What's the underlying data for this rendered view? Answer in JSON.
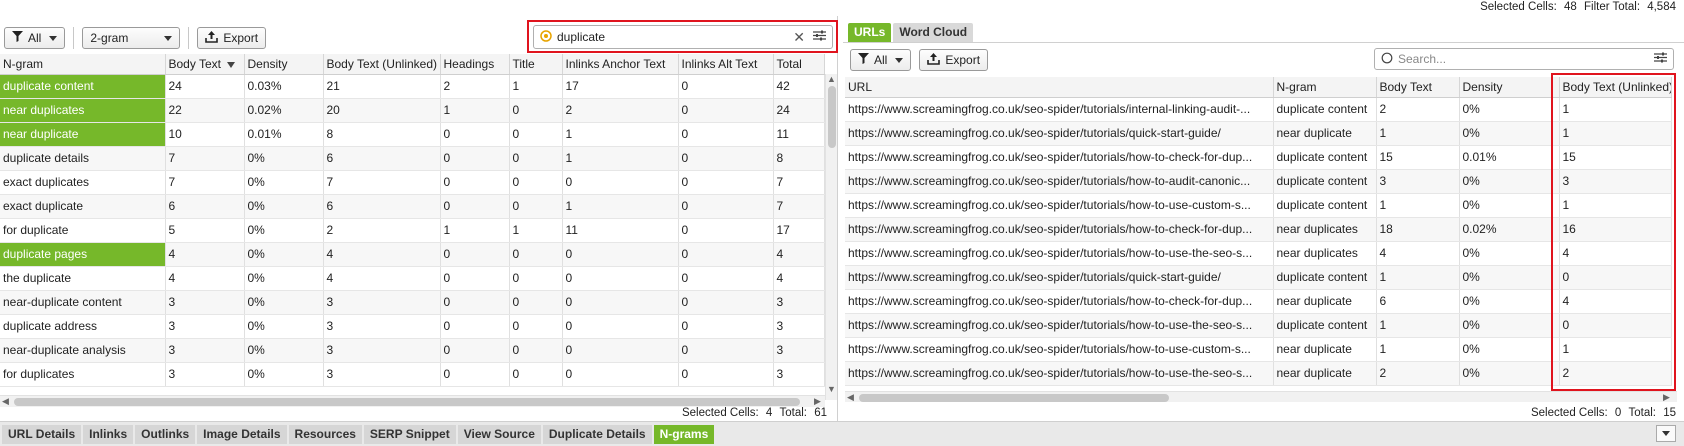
{
  "top_status": {
    "selected_label": "Selected Cells:",
    "selected_value": "48",
    "filter_label": "Filter Total:",
    "filter_value": "4,584"
  },
  "left": {
    "filter_button": "All",
    "ngram_select": "2-gram",
    "export_button": "Export",
    "search_value": "duplicate",
    "columns": [
      "N-gram",
      "Body Text",
      "Density",
      "Body Text (Unlinked)",
      "Headings",
      "Title",
      "Inlinks Anchor Text",
      "Inlinks Alt Text",
      "Total"
    ],
    "rows": [
      {
        "cells": [
          "duplicate content",
          "24",
          "0.03%",
          "21",
          "2",
          "1",
          "17",
          "0",
          "42"
        ],
        "hl": true
      },
      {
        "cells": [
          "near duplicates",
          "22",
          "0.02%",
          "20",
          "1",
          "0",
          "2",
          "0",
          "24"
        ],
        "hl": true
      },
      {
        "cells": [
          "near duplicate",
          "10",
          "0.01%",
          "8",
          "0",
          "0",
          "1",
          "0",
          "11"
        ],
        "hl": true
      },
      {
        "cells": [
          "duplicate details",
          "7",
          "0%",
          "6",
          "0",
          "0",
          "1",
          "0",
          "8"
        ],
        "hl": false
      },
      {
        "cells": [
          "exact duplicates",
          "7",
          "0%",
          "7",
          "0",
          "0",
          "0",
          "0",
          "7"
        ],
        "hl": false
      },
      {
        "cells": [
          "exact duplicate",
          "6",
          "0%",
          "6",
          "0",
          "0",
          "1",
          "0",
          "7"
        ],
        "hl": false
      },
      {
        "cells": [
          "for duplicate",
          "5",
          "0%",
          "2",
          "1",
          "1",
          "11",
          "0",
          "17"
        ],
        "hl": false
      },
      {
        "cells": [
          "duplicate pages",
          "4",
          "0%",
          "4",
          "0",
          "0",
          "0",
          "0",
          "4"
        ],
        "hl": true
      },
      {
        "cells": [
          "the duplicate",
          "4",
          "0%",
          "4",
          "0",
          "0",
          "0",
          "0",
          "4"
        ],
        "hl": false
      },
      {
        "cells": [
          "near-duplicate content",
          "3",
          "0%",
          "3",
          "0",
          "0",
          "0",
          "0",
          "3"
        ],
        "hl": false
      },
      {
        "cells": [
          "duplicate address",
          "3",
          "0%",
          "3",
          "0",
          "0",
          "0",
          "0",
          "3"
        ],
        "hl": false
      },
      {
        "cells": [
          "near-duplicate analysis",
          "3",
          "0%",
          "3",
          "0",
          "0",
          "0",
          "0",
          "3"
        ],
        "hl": false
      },
      {
        "cells": [
          "for duplicates",
          "3",
          "0%",
          "3",
          "0",
          "0",
          "0",
          "0",
          "3"
        ],
        "hl": false
      }
    ],
    "status": {
      "selected_label": "Selected Cells:",
      "selected_value": "4",
      "total_label": "Total:",
      "total_value": "61"
    }
  },
  "right": {
    "tabs": [
      {
        "label": "URLs",
        "active": true
      },
      {
        "label": "Word Cloud",
        "active": false
      }
    ],
    "filter_button": "All",
    "export_button": "Export",
    "search_placeholder": "Search...",
    "columns": [
      "URL",
      "N-gram",
      "Body Text",
      "Density",
      "Body Text (Unlinked)"
    ],
    "rows": [
      [
        "https://www.screamingfrog.co.uk/seo-spider/tutorials/internal-linking-audit-...",
        "duplicate content",
        "2",
        "0%",
        "1"
      ],
      [
        "https://www.screamingfrog.co.uk/seo-spider/tutorials/quick-start-guide/",
        "near duplicate",
        "1",
        "0%",
        "1"
      ],
      [
        "https://www.screamingfrog.co.uk/seo-spider/tutorials/how-to-check-for-dup...",
        "duplicate content",
        "15",
        "0.01%",
        "15"
      ],
      [
        "https://www.screamingfrog.co.uk/seo-spider/tutorials/how-to-audit-canonic...",
        "duplicate content",
        "3",
        "0%",
        "3"
      ],
      [
        "https://www.screamingfrog.co.uk/seo-spider/tutorials/how-to-use-custom-s...",
        "duplicate content",
        "1",
        "0%",
        "1"
      ],
      [
        "https://www.screamingfrog.co.uk/seo-spider/tutorials/how-to-check-for-dup...",
        "near duplicates",
        "18",
        "0.02%",
        "16"
      ],
      [
        "https://www.screamingfrog.co.uk/seo-spider/tutorials/how-to-use-the-seo-s...",
        "near duplicates",
        "4",
        "0%",
        "4"
      ],
      [
        "https://www.screamingfrog.co.uk/seo-spider/tutorials/quick-start-guide/",
        "duplicate content",
        "1",
        "0%",
        "0"
      ],
      [
        "https://www.screamingfrog.co.uk/seo-spider/tutorials/how-to-check-for-dup...",
        "near duplicate",
        "6",
        "0%",
        "4"
      ],
      [
        "https://www.screamingfrog.co.uk/seo-spider/tutorials/how-to-use-the-seo-s...",
        "duplicate content",
        "1",
        "0%",
        "0"
      ],
      [
        "https://www.screamingfrog.co.uk/seo-spider/tutorials/how-to-use-custom-s...",
        "near duplicate",
        "1",
        "0%",
        "1"
      ],
      [
        "https://www.screamingfrog.co.uk/seo-spider/tutorials/how-to-use-the-seo-s...",
        "near duplicate",
        "2",
        "0%",
        "2"
      ]
    ],
    "status": {
      "selected_label": "Selected Cells:",
      "selected_value": "0",
      "total_label": "Total:",
      "total_value": "15"
    }
  },
  "bottom_tabs": [
    {
      "label": "URL Details",
      "active": false
    },
    {
      "label": "Inlinks",
      "active": false
    },
    {
      "label": "Outlinks",
      "active": false
    },
    {
      "label": "Image Details",
      "active": false
    },
    {
      "label": "Resources",
      "active": false
    },
    {
      "label": "SERP Snippet",
      "active": false
    },
    {
      "label": "View Source",
      "active": false
    },
    {
      "label": "Duplicate Details",
      "active": false
    },
    {
      "label": "N-grams",
      "active": true
    }
  ],
  "colors": {
    "accent": "#76b82a",
    "highlight_box": "#e0141e"
  }
}
